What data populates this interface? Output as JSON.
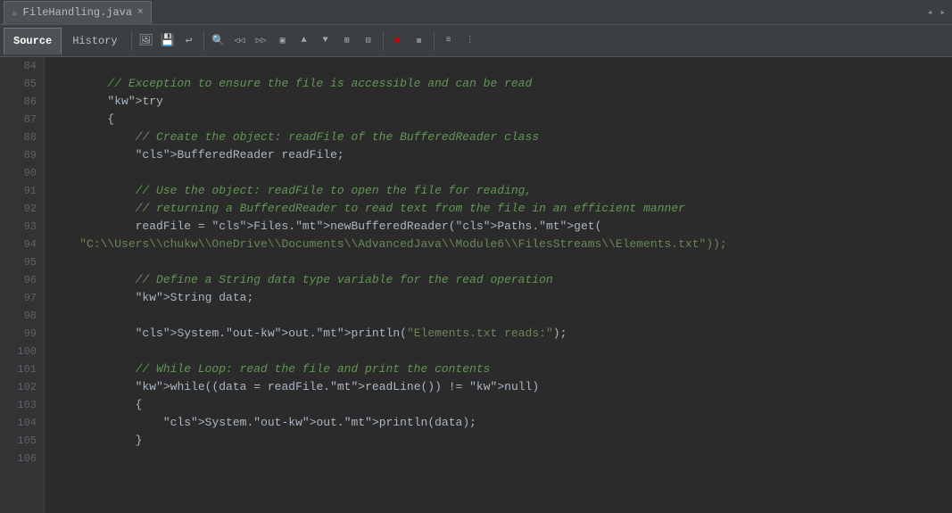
{
  "titleBar": {
    "filename": "FileHandling.java",
    "closeLabel": "×"
  },
  "tabs": {
    "source": "Source",
    "history": "History"
  },
  "navArrows": {
    "left": "◂",
    "right": "▸"
  },
  "toolbar": {
    "buttons": [
      "⟲",
      "⊡",
      "↙",
      "⊠",
      "▸▸",
      "◃◃",
      "▹",
      "◃",
      "⟐",
      "⊞",
      "⊟",
      "⊙",
      "⊗",
      "⊗",
      "≡",
      "≡"
    ]
  },
  "lines": [
    {
      "num": "84",
      "content": ""
    },
    {
      "num": "85",
      "content": "        // Exception to ensure the file is accessible and can be read"
    },
    {
      "num": "86",
      "content": "        try"
    },
    {
      "num": "87",
      "content": "        {"
    },
    {
      "num": "88",
      "content": "            // Create the object: readFile of the BufferedReader class"
    },
    {
      "num": "89",
      "content": "            BufferedReader readFile;"
    },
    {
      "num": "90",
      "content": ""
    },
    {
      "num": "91",
      "content": "            // Use the object: readFile to open the file for reading,"
    },
    {
      "num": "92",
      "content": "            // returning a BufferedReader to read text from the file in an efficient manner"
    },
    {
      "num": "93",
      "content": "            readFile = Files.newBufferedReader(Paths.get("
    },
    {
      "num": "94",
      "content": "    \"C:\\\\Users\\\\chukw\\\\OneDrive\\\\Documents\\\\AdvancedJava\\\\Module6\\\\FilesStreams\\\\Elements.txt\"));"
    },
    {
      "num": "95",
      "content": ""
    },
    {
      "num": "96",
      "content": "            // Define a String data type variable for the read operation"
    },
    {
      "num": "97",
      "content": "            String data;"
    },
    {
      "num": "98",
      "content": ""
    },
    {
      "num": "99",
      "content": "            System.out.println(\"Elements.txt reads:\");"
    },
    {
      "num": "100",
      "content": ""
    },
    {
      "num": "101",
      "content": "            // While Loop: read the file and print the contents"
    },
    {
      "num": "102",
      "content": "            while((data = readFile.readLine()) != null)"
    },
    {
      "num": "103",
      "content": "            {"
    },
    {
      "num": "104",
      "content": "                System.out.println(data);"
    },
    {
      "num": "105",
      "content": "            }"
    },
    {
      "num": "106",
      "content": ""
    }
  ]
}
